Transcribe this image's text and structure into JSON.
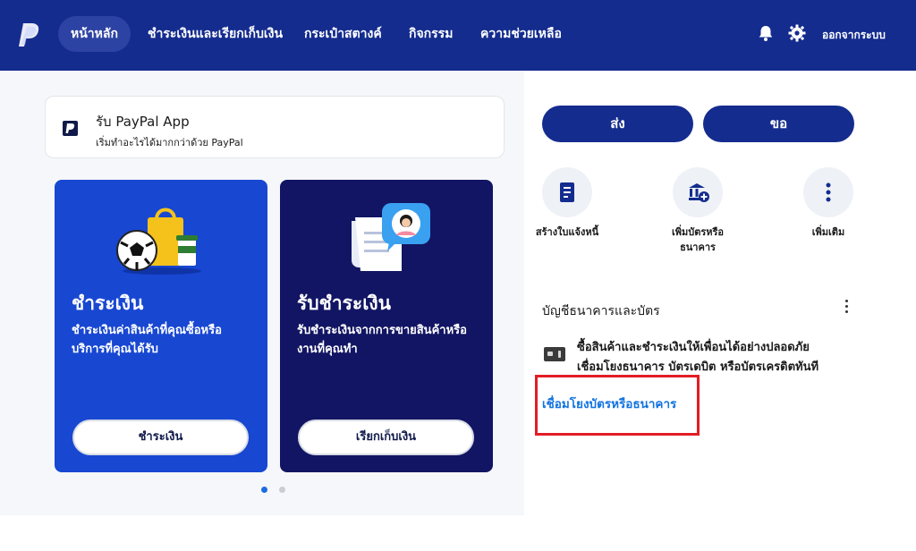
{
  "nav": {
    "items": [
      {
        "label": "หน้าหลัก"
      },
      {
        "label": "ชำระเงินและเรียกเก็บเงิน"
      },
      {
        "label": "กระเป๋าสตางค์"
      },
      {
        "label": "กิจกรรม"
      },
      {
        "label": "ความช่วยเหลือ"
      }
    ],
    "logout": "ออกจากระบบ",
    "colors": {
      "bar": "#142c8e",
      "active": "#2d43a3"
    }
  },
  "app_banner": {
    "title": "รับ PayPal App",
    "subtitle": "เริ่มทำอะไรได้มากกว่าด้วย PayPal"
  },
  "promos": [
    {
      "title": "ชำระเงิน",
      "desc": "ชำระเงินค่าสินค้าที่คุณซื้อหรือบริการที่คุณได้รับ",
      "button": "ชำระเงิน"
    },
    {
      "title": "รับชำระเงิน",
      "desc": "รับชำระเงินจากการขายสินค้าหรืองานที่คุณทำ",
      "button": "เรียกเก็บเงิน"
    }
  ],
  "actions": {
    "send": "ส่ง",
    "request": "ขอ"
  },
  "quick_actions": [
    {
      "label": "สร้างใบแจ้งหนี้",
      "icon": "invoice-icon"
    },
    {
      "label": "เพิ่มบัตรหรือธนาคาร",
      "icon": "add-bank-icon"
    },
    {
      "label": "เพิ่มเติม",
      "icon": "more-vertical-icon"
    }
  ],
  "bank_section": {
    "title": "บัญชีธนาคารและบัตร",
    "line1": "ซื้อสินค้าและชำระเงินให้เพื่อนได้อย่างปลอดภัย",
    "line2": "เชื่อมโยงธนาคาร บัตรเดบิต หรือบัตรเครดิตทันที",
    "link": "เชื่อมโยงบัตรหรือธนาคาร"
  }
}
